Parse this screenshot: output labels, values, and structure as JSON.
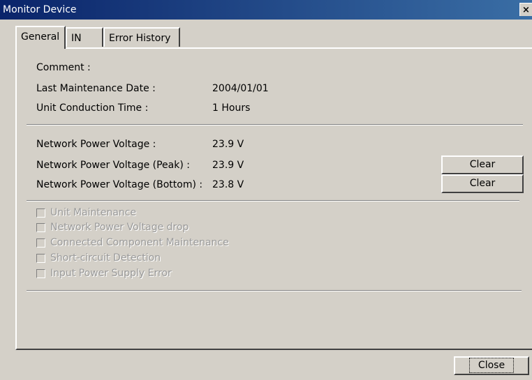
{
  "window": {
    "title": "Monitor Device",
    "close_glyph": "×"
  },
  "tabs": [
    {
      "label": "General",
      "active": true
    },
    {
      "label": "IN",
      "active": false
    },
    {
      "label": "Error History",
      "active": false
    }
  ],
  "general": {
    "comment_label": "Comment :",
    "last_maintenance_label": "Last Maintenance Date :",
    "last_maintenance_value": "2004/01/01",
    "conduction_label": "Unit Conduction Time :",
    "conduction_value": "1 Hours",
    "voltage_label": "Network Power Voltage :",
    "voltage_value": "23.9 V",
    "peak_label": "Network Power Voltage (Peak) :",
    "peak_value": "23.9 V",
    "bottom_label": "Network Power Voltage (Bottom) :",
    "bottom_value": "23.8 V",
    "clear_peak_label": "Clear",
    "clear_bottom_label": "Clear"
  },
  "checkboxes": [
    {
      "label": "Unit Maintenance",
      "checked": false,
      "enabled": false
    },
    {
      "label": "Network Power Voltage drop",
      "checked": false,
      "enabled": false
    },
    {
      "label": "Connected Component Maintenance",
      "checked": false,
      "enabled": false
    },
    {
      "label": "Short-circuit Detection",
      "checked": false,
      "enabled": false
    },
    {
      "label": "Input Power Supply Error",
      "checked": false,
      "enabled": false
    }
  ],
  "footer": {
    "close_label": "Close"
  }
}
